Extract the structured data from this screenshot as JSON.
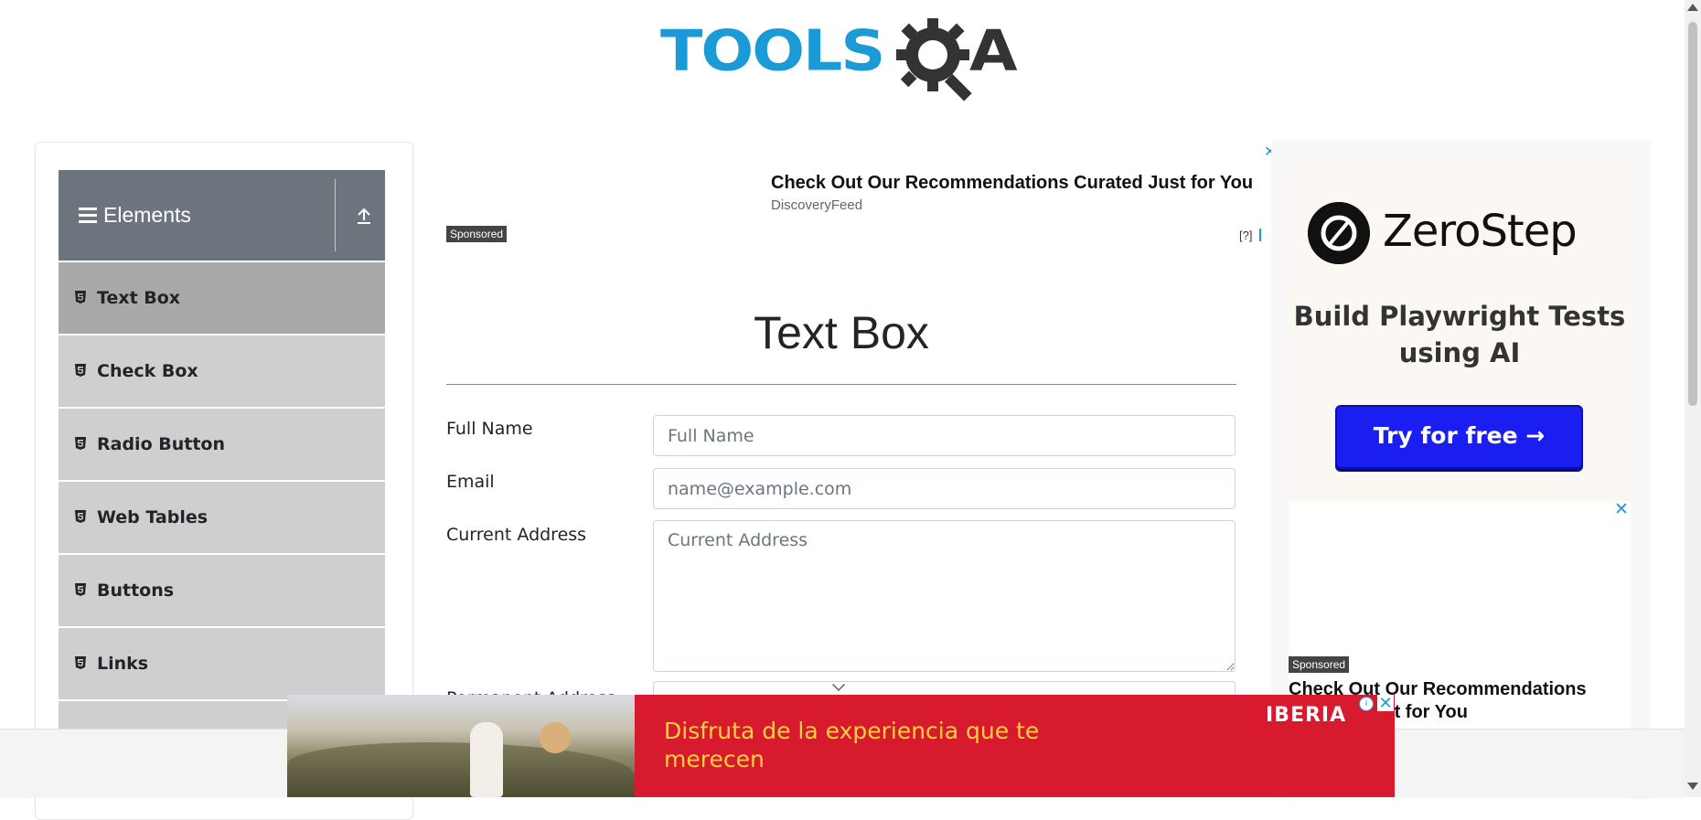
{
  "header": {
    "logo_left": "TOOLS",
    "logo_right": "A"
  },
  "sidebar": {
    "group_title": "Elements",
    "items": [
      {
        "label": "Text Box"
      },
      {
        "label": "Check Box"
      },
      {
        "label": "Radio Button"
      },
      {
        "label": "Web Tables"
      },
      {
        "label": "Buttons"
      },
      {
        "label": "Links"
      }
    ]
  },
  "top_ad": {
    "title": "Check Out Our Recommendations Curated Just for You",
    "source": "DiscoveryFeed",
    "sponsored": "Sponsored",
    "help": "[?]",
    "close": "✕"
  },
  "main": {
    "title": "Text Box",
    "fields": {
      "full_name": {
        "label": "Full Name",
        "placeholder": "Full Name"
      },
      "email": {
        "label": "Email",
        "placeholder": "name@example.com"
      },
      "current_address": {
        "label": "Current Address",
        "placeholder": "Current Address"
      },
      "permanent_address": {
        "label": "Permanent Address"
      }
    }
  },
  "right_ad": {
    "brand": "ZeroStep",
    "tagline": "Build Playwright Tests using AI",
    "button": "Try for free →",
    "sponsored": "Sponsored",
    "title": "Check Out Our Recommendations Curated Just for You",
    "close": "✕"
  },
  "banner": {
    "text": "Disfruta de la experiencia que te merecen",
    "brand": "IBERIA",
    "info": "i",
    "close": "✕"
  },
  "colors": {
    "accent": "#1a9ad6",
    "sidebar_header": "#6c757d",
    "sidebar_item": "#cfcfcf",
    "sidebar_active": "#a9a9a9",
    "banner": "#d71a2d",
    "banner_text": "#ffd03f"
  }
}
